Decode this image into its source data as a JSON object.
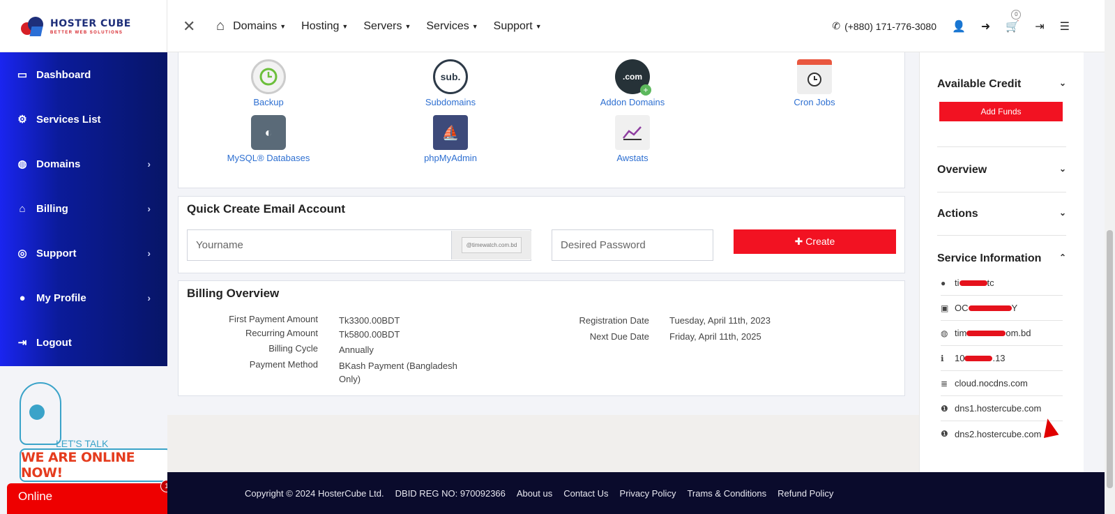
{
  "brand": {
    "name": "HOSTER CUBE",
    "tagline": "BETTER WEB SOLUTIONS"
  },
  "topnav": {
    "menu": [
      "Domains",
      "Hosting",
      "Servers",
      "Services",
      "Support"
    ],
    "phone": "(+880) 171-776-3080",
    "cart_count": "0"
  },
  "sidebar": {
    "items": [
      {
        "label": "Dashboard",
        "icon": "monitor-icon",
        "has_chevron": false
      },
      {
        "label": "Services List",
        "icon": "gears-icon",
        "has_chevron": false
      },
      {
        "label": "Domains",
        "icon": "globe-icon",
        "has_chevron": true
      },
      {
        "label": "Billing",
        "icon": "bank-icon",
        "has_chevron": true
      },
      {
        "label": "Support",
        "icon": "lifebuoy-icon",
        "has_chevron": true
      },
      {
        "label": "My Profile",
        "icon": "user-icon",
        "has_chevron": true
      },
      {
        "label": "Logout",
        "icon": "logout-icon",
        "has_chevron": false
      }
    ]
  },
  "chat": {
    "lets_talk": "LET'S TALK",
    "online_now": "WE ARE ONLINE NOW!",
    "status": "Online",
    "badge": "1"
  },
  "tools": [
    {
      "label": "Backup",
      "icon": "backup-icon"
    },
    {
      "label": "Subdomains",
      "icon": "subdomain-icon"
    },
    {
      "label": "Addon Domains",
      "icon": "addon-domain-icon"
    },
    {
      "label": "Cron Jobs",
      "icon": "cron-icon"
    },
    {
      "label": "MySQL® Databases",
      "icon": "mysql-icon"
    },
    {
      "label": "phpMyAdmin",
      "icon": "phpmyadmin-icon"
    },
    {
      "label": "Awstats",
      "icon": "awstats-icon"
    }
  ],
  "email": {
    "title": "Quick Create Email Account",
    "username_placeholder": "Yourname",
    "domain_suffix": "@timewatch.com.bd",
    "password_placeholder": "Desired Password",
    "create_label": "Create"
  },
  "billing": {
    "title": "Billing Overview",
    "first_payment_label": "First Payment Amount",
    "first_payment_value": "Tk3300.00BDT",
    "recurring_label": "Recurring Amount",
    "recurring_value": "Tk5800.00BDT",
    "cycle_label": "Billing Cycle",
    "cycle_value": "Annually",
    "method_label": "Payment Method",
    "method_value": "BKash Payment (Bangladesh Only)",
    "reg_date_label": "Registration Date",
    "reg_date_value": "Tuesday, April 11th, 2023",
    "due_date_label": "Next Due Date",
    "due_date_value": "Friday, April 11th, 2025"
  },
  "rpanel": {
    "credit_title": "Available Credit",
    "add_funds": "Add Funds",
    "overview_title": "Overview",
    "actions_title": "Actions",
    "service_title": "Service Information",
    "info": [
      {
        "icon": "user-icon",
        "pre": "ti",
        "post": "tc"
      },
      {
        "icon": "lock-icon",
        "pre": "OC",
        "post": "Y"
      },
      {
        "icon": "globe-icon",
        "pre": "tim",
        "post": "om.bd"
      },
      {
        "icon": "info-icon",
        "pre": "10",
        "post": ".13"
      },
      {
        "icon": "server-icon",
        "text": "cloud.nocdns.com"
      },
      {
        "icon": "info-circle-icon",
        "text": "dns1.hostercube.com"
      },
      {
        "icon": "info-circle-icon",
        "text": "dns2.hostercube.com"
      }
    ]
  },
  "footer": {
    "copyright": "Copyright © 2024 HosterCube Ltd.",
    "dbid": "DBID REG NO: 970092366",
    "links": [
      "About us",
      "Contact Us",
      "Privacy Policy",
      "Trams & Conditions",
      "Refund Policy"
    ]
  }
}
